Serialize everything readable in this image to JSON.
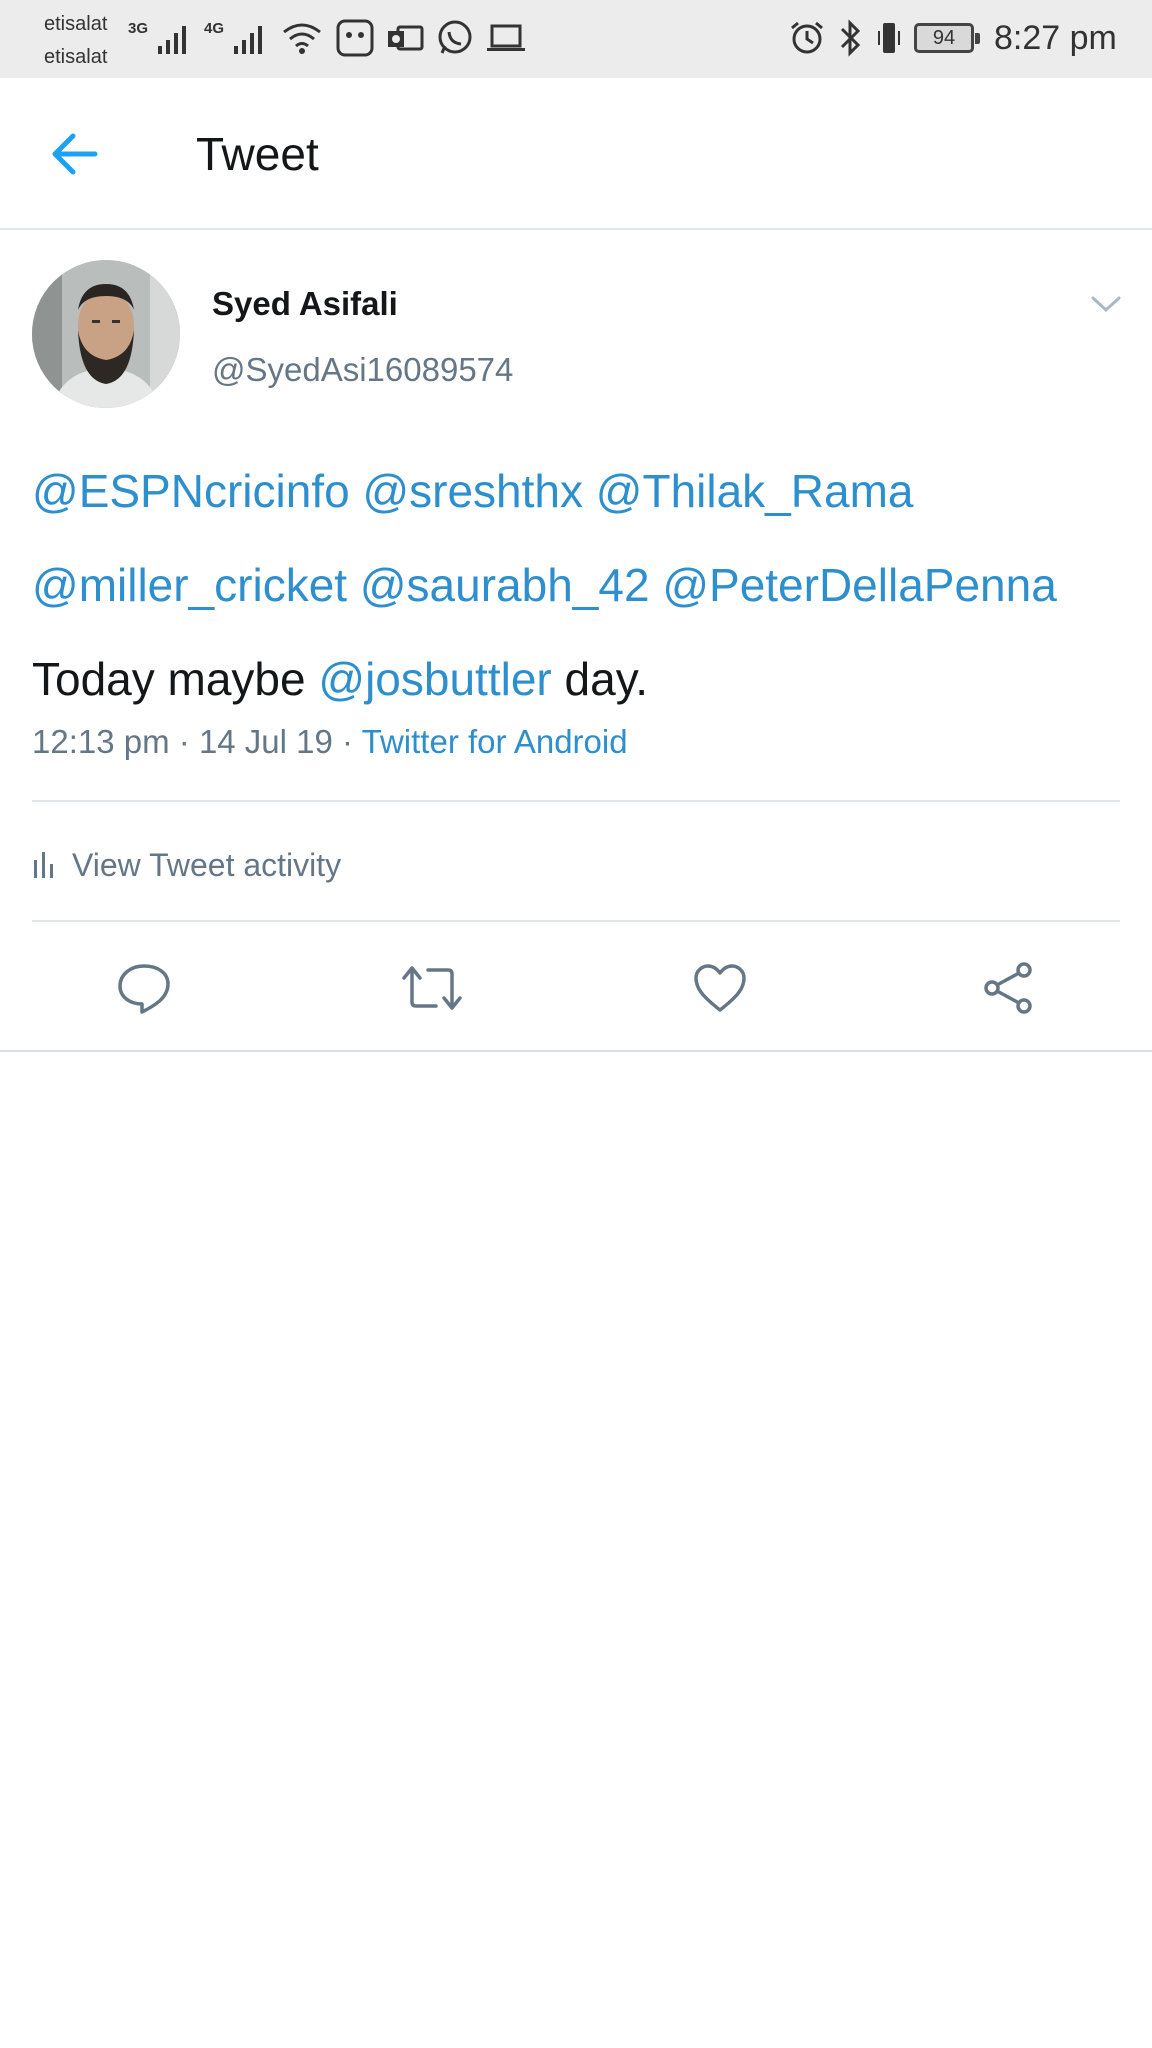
{
  "status_bar": {
    "carrier_1": "etisalat",
    "carrier_2": "etisalat",
    "network_1": "3G",
    "network_2": "4G",
    "battery_level": "94",
    "time": "8:27 pm"
  },
  "header": {
    "title": "Tweet"
  },
  "tweet": {
    "display_name": "Syed Asifali",
    "username": "@SyedAsi16089574",
    "mentions_line_1": [
      "@ESPNcricinfo",
      "@sreshthx",
      "@Thilak_Rama"
    ],
    "mentions_line_2": [
      "@miller_cricket",
      "@saurabh_42",
      "@PeterDellaPenna"
    ],
    "text_before": "Today maybe",
    "text_mention": "@josbuttler",
    "text_after": "day.",
    "time": "12:13 pm",
    "separator": "·",
    "date": "14 Jul 19",
    "source": "Twitter for Android",
    "activity_label": "View Tweet activity"
  },
  "colors": {
    "link": "#2e8fce",
    "text": "#14171a",
    "secondary": "#657786",
    "icon": "#657786",
    "accent": "#1da1f2"
  }
}
